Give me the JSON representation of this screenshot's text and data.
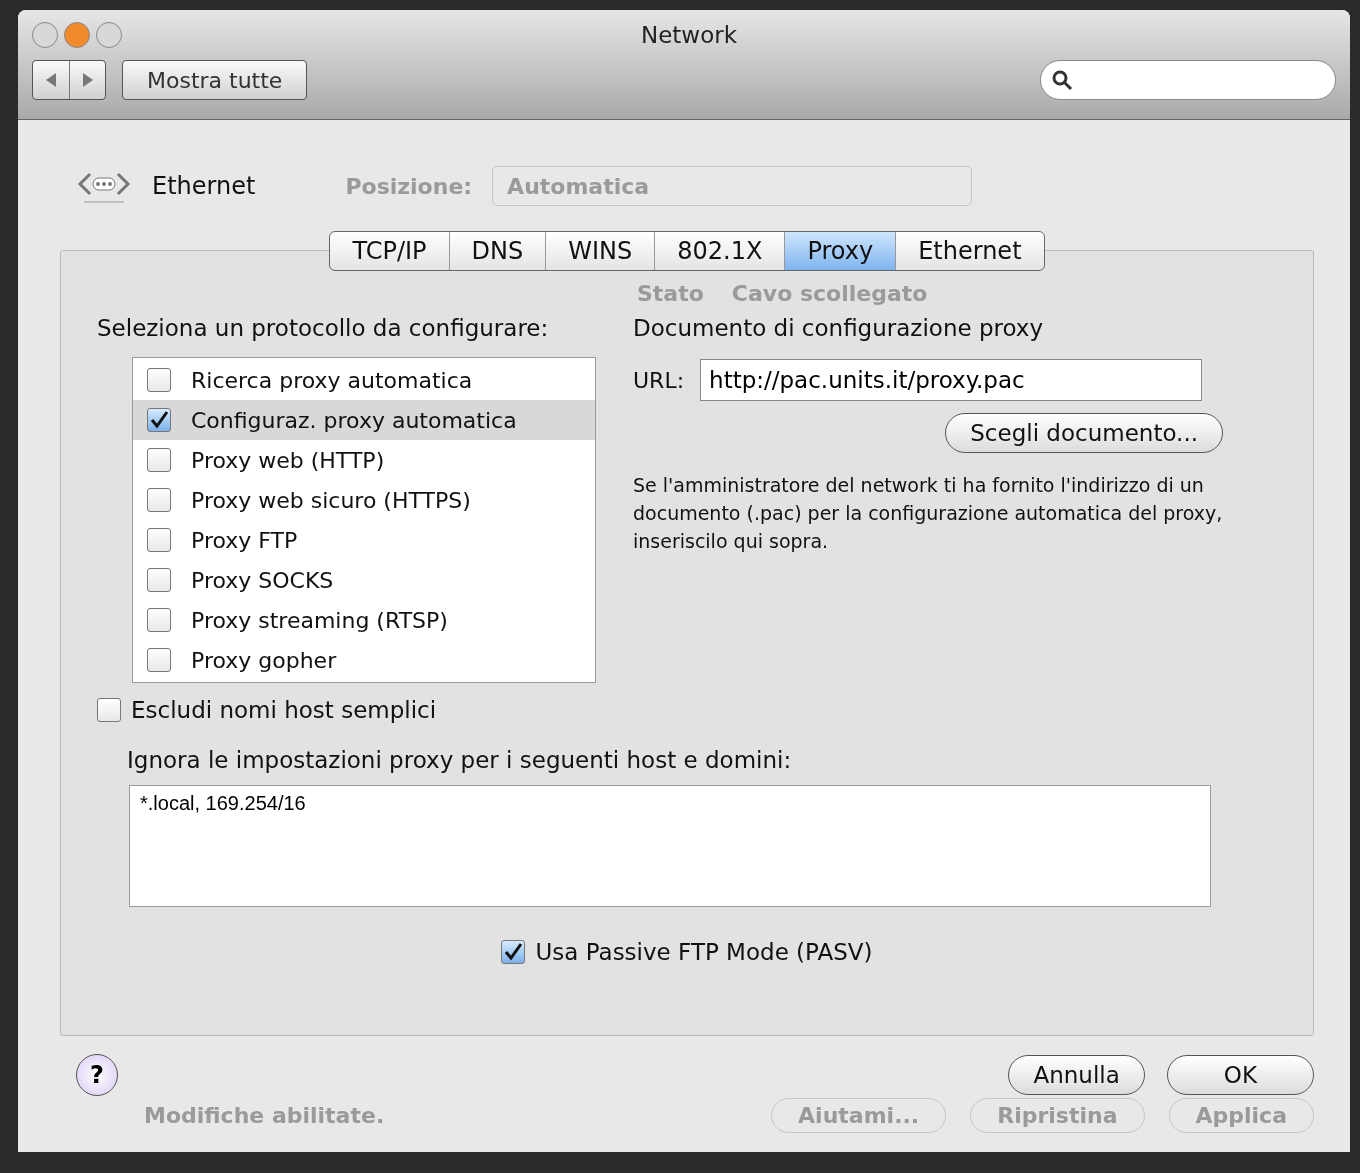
{
  "window": {
    "title": "Network"
  },
  "toolbar": {
    "show_all": "Mostra tutte"
  },
  "header": {
    "service": "Ethernet",
    "location_label": "Posizione:",
    "location_value": "Automatica"
  },
  "tabs": [
    {
      "label": "TCP/IP",
      "selected": false
    },
    {
      "label": "DNS",
      "selected": false
    },
    {
      "label": "WINS",
      "selected": false
    },
    {
      "label": "802.1X",
      "selected": false
    },
    {
      "label": "Proxy",
      "selected": true
    },
    {
      "label": "Ethernet",
      "selected": false
    }
  ],
  "status": {
    "label": "Stato",
    "value": "Cavo scollegato"
  },
  "protocols": {
    "title": "Seleziona un protocollo da configurare:",
    "items": [
      {
        "label": "Ricerca proxy automatica",
        "checked": false,
        "selected": false
      },
      {
        "label": "Configuraz. proxy automatica",
        "checked": true,
        "selected": true
      },
      {
        "label": "Proxy web (HTTP)",
        "checked": false,
        "selected": false
      },
      {
        "label": "Proxy web sicuro (HTTPS)",
        "checked": false,
        "selected": false
      },
      {
        "label": "Proxy FTP",
        "checked": false,
        "selected": false
      },
      {
        "label": "Proxy SOCKS",
        "checked": false,
        "selected": false
      },
      {
        "label": "Proxy streaming (RTSP)",
        "checked": false,
        "selected": false
      },
      {
        "label": "Proxy gopher",
        "checked": false,
        "selected": false
      }
    ]
  },
  "config": {
    "title": "Documento di configurazione proxy",
    "url_label": "URL:",
    "url_value": "http://pac.units.it/proxy.pac",
    "choose": "Scegli documento...",
    "help": "Se l'amministratore del network ti ha fornito l'indirizzo di un documento (.pac) per la configurazione automatica del proxy, inseriscilo qui sopra."
  },
  "exclude_simple": {
    "label": "Escludi nomi host semplici",
    "checked": false
  },
  "bypass": {
    "label": "Ignora le impostazioni proxy per i seguenti host e domini:",
    "value": "*.local, 169.254/16"
  },
  "pasv": {
    "label": "Usa Passive FTP Mode (PASV)",
    "checked": true
  },
  "buttons": {
    "help": "?",
    "cancel": "Annulla",
    "ok": "OK"
  },
  "behind": {
    "status": "Modifiche abilitate.",
    "buttons": [
      "Aiutami...",
      "Ripristina",
      "Applica"
    ]
  }
}
